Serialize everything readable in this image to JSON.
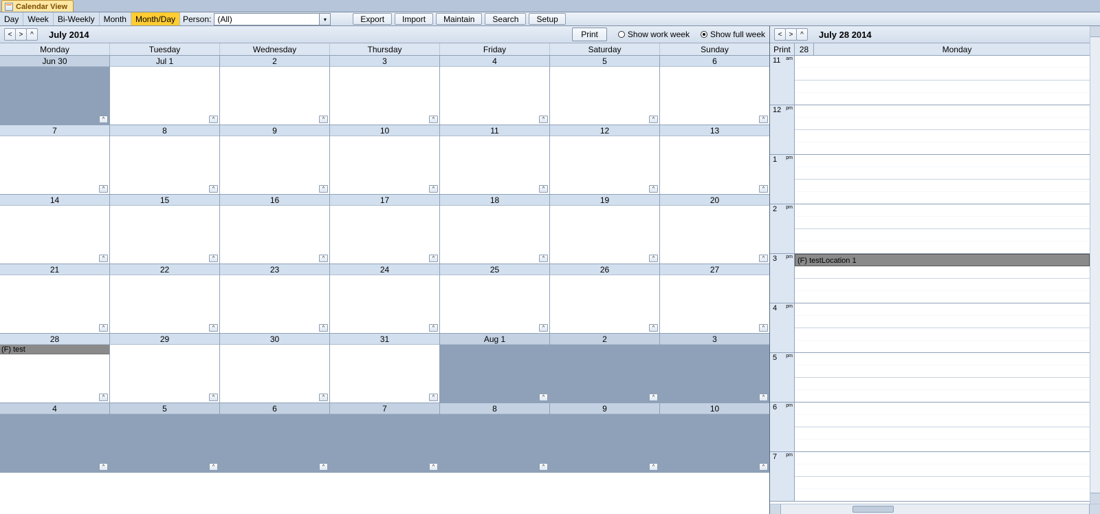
{
  "tab_title": "Calendar View",
  "modes": {
    "day": "Day",
    "week": "Week",
    "biweekly": "Bi-Weekly",
    "month": "Month",
    "monthday": "Month/Day"
  },
  "person_label": "Person:",
  "person_value": "(All)",
  "tool": {
    "export": "Export",
    "import": "Import",
    "maintain": "Maintain",
    "search": "Search",
    "setup": "Setup"
  },
  "month_header": {
    "title": "July 2014",
    "print": "Print",
    "work_week": "Show work week",
    "full_week": "Show full week"
  },
  "dow": [
    "Monday",
    "Tuesday",
    "Wednesday",
    "Thursday",
    "Friday",
    "Saturday",
    "Sunday"
  ],
  "weeks": [
    [
      {
        "label": "Jun 30",
        "outside": true
      },
      {
        "label": "Jul 1"
      },
      {
        "label": "2"
      },
      {
        "label": "3"
      },
      {
        "label": "4"
      },
      {
        "label": "5"
      },
      {
        "label": "6"
      }
    ],
    [
      {
        "label": "7"
      },
      {
        "label": "8"
      },
      {
        "label": "9"
      },
      {
        "label": "10"
      },
      {
        "label": "11"
      },
      {
        "label": "12"
      },
      {
        "label": "13"
      }
    ],
    [
      {
        "label": "14"
      },
      {
        "label": "15"
      },
      {
        "label": "16"
      },
      {
        "label": "17"
      },
      {
        "label": "18"
      },
      {
        "label": "19"
      },
      {
        "label": "20"
      }
    ],
    [
      {
        "label": "21"
      },
      {
        "label": "22"
      },
      {
        "label": "23"
      },
      {
        "label": "24"
      },
      {
        "label": "25"
      },
      {
        "label": "26"
      },
      {
        "label": "27"
      }
    ],
    [
      {
        "label": "28",
        "event": "(F) test"
      },
      {
        "label": "29"
      },
      {
        "label": "30"
      },
      {
        "label": "31"
      },
      {
        "label": "Aug 1",
        "outside": true
      },
      {
        "label": "2",
        "outside": true
      },
      {
        "label": "3",
        "outside": true
      }
    ],
    [
      {
        "label": "4",
        "outside": true
      },
      {
        "label": "5",
        "outside": true
      },
      {
        "label": "6",
        "outside": true
      },
      {
        "label": "7",
        "outside": true
      },
      {
        "label": "8",
        "outside": true
      },
      {
        "label": "9",
        "outside": true
      },
      {
        "label": "10",
        "outside": true
      }
    ]
  ],
  "day_header": {
    "title": "July 28 2014",
    "print": "Print",
    "num": "28",
    "dow": "Monday"
  },
  "hours": [
    {
      "h": "11",
      "ap": "am"
    },
    {
      "h": "12",
      "ap": "pm"
    },
    {
      "h": "1",
      "ap": "pm"
    },
    {
      "h": "2",
      "ap": "pm"
    },
    {
      "h": "3",
      "ap": "pm",
      "event": "(F) testLocation 1"
    },
    {
      "h": "4",
      "ap": "pm"
    },
    {
      "h": "5",
      "ap": "pm"
    },
    {
      "h": "6",
      "ap": "pm"
    },
    {
      "h": "7",
      "ap": "pm"
    }
  ],
  "glyph": {
    "prev": "<",
    "next": ">",
    "up": "^",
    "caret": "^",
    "combo": "▾"
  }
}
